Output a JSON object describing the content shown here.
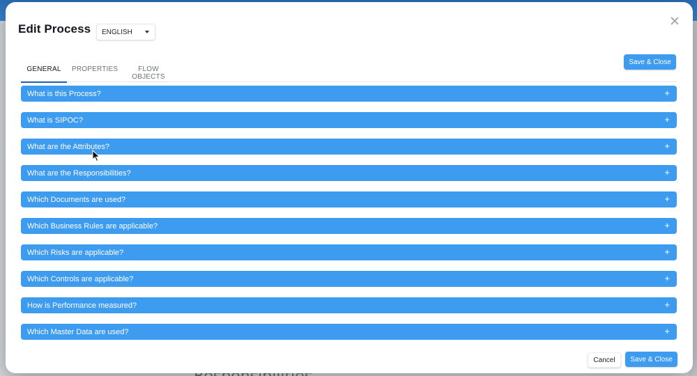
{
  "modal": {
    "title": "Edit Process",
    "language": "ENGLISH",
    "save_top_label": "Save & Close",
    "save_bottom_label": "Save & Close",
    "cancel_label": "Cancel"
  },
  "tabs": [
    {
      "label": "GENERAL",
      "active": true
    },
    {
      "label": "PROPERTIES",
      "active": false
    },
    {
      "label": "FLOW OBJECTS",
      "active": false
    }
  ],
  "sections": [
    {
      "label": "What is this Process?"
    },
    {
      "label": "What is SIPOC?"
    },
    {
      "label": "What are the Attributes?"
    },
    {
      "label": "What are the Responsibilities?"
    },
    {
      "label": "Which Documents are used?"
    },
    {
      "label": "Which Business Rules are applicable?"
    },
    {
      "label": "Which Risks are applicable?"
    },
    {
      "label": "Which Controls are applicable?"
    },
    {
      "label": "How is Performance measured?"
    },
    {
      "label": "Which Master Data are used?"
    }
  ],
  "expand_symbol": "+",
  "background": {
    "fragment_text": "Responsibilities"
  },
  "colors": {
    "accent": "#3d9bf0",
    "tab_underline": "#1f5fa8"
  },
  "icons": {
    "close": "close-icon",
    "dropdown": "chevron-down-icon",
    "expand": "plus-icon",
    "cursor": "mouse-pointer-icon"
  }
}
